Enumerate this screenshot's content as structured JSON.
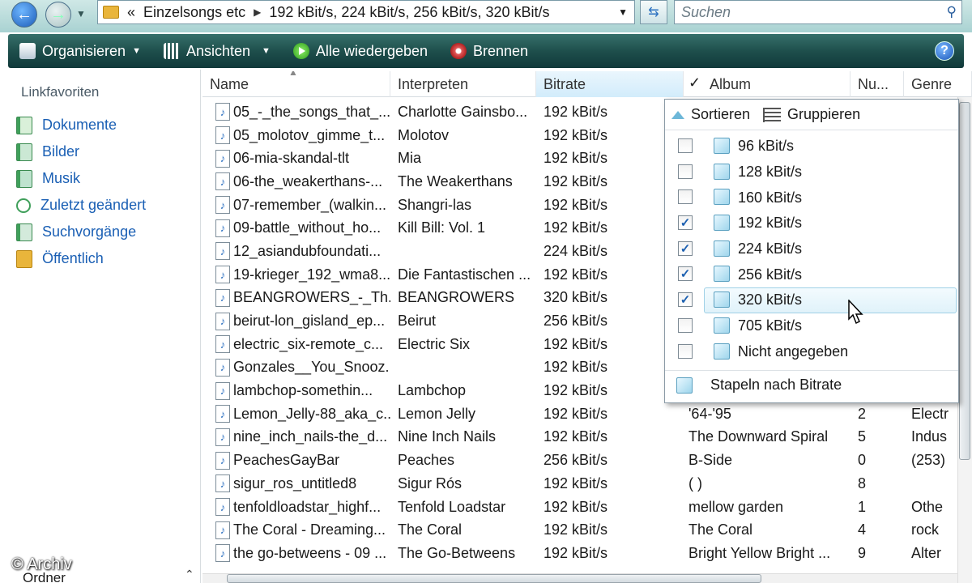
{
  "address": {
    "path_prefix": "«",
    "crumbs": [
      "Einzelsongs etc",
      "192 kBit/s, 224 kBit/s, 256 kBit/s, 320 kBit/s"
    ],
    "search_placeholder": "Suchen"
  },
  "toolbar": {
    "organize": "Organisieren",
    "views": "Ansichten",
    "play_all": "Alle wiedergeben",
    "burn": "Brennen",
    "help": "?"
  },
  "nav": {
    "heading": "Linkfavoriten",
    "items": [
      {
        "label": "Dokumente",
        "icon": "documents-icon"
      },
      {
        "label": "Bilder",
        "icon": "pictures-icon"
      },
      {
        "label": "Musik",
        "icon": "music-icon"
      },
      {
        "label": "Zuletzt geändert",
        "icon": "recent-icon"
      },
      {
        "label": "Suchvorgänge",
        "icon": "searches-icon"
      },
      {
        "label": "Öffentlich",
        "icon": "public-folder-icon"
      }
    ],
    "folders_label": "Ordner"
  },
  "columns": {
    "name": "Name",
    "artist": "Interpreten",
    "bitrate": "Bitrate",
    "album": "Album",
    "num": "Nu...",
    "genre": "Genre"
  },
  "rows": [
    {
      "name": "05_-_the_songs_that_...",
      "artist": "Charlotte Gainsbo...",
      "bitrate": "192 kBit/s",
      "album": "",
      "num": "",
      "genre": ""
    },
    {
      "name": "05_molotov_gimme_t...",
      "artist": "Molotov",
      "bitrate": "192 kBit/s",
      "album": "",
      "num": "",
      "genre": ""
    },
    {
      "name": "06-mia-skandal-tlt",
      "artist": "Mia",
      "bitrate": "192 kBit/s",
      "album": "",
      "num": "",
      "genre": ""
    },
    {
      "name": "06-the_weakerthans-...",
      "artist": "The Weakerthans",
      "bitrate": "192 kBit/s",
      "album": "",
      "num": "",
      "genre": ""
    },
    {
      "name": "07-remember_(walkin...",
      "artist": "Shangri-las",
      "bitrate": "192 kBit/s",
      "album": "",
      "num": "",
      "genre": ""
    },
    {
      "name": "09-battle_without_ho...",
      "artist": "Kill Bill: Vol. 1",
      "bitrate": "192 kBit/s",
      "album": "",
      "num": "",
      "genre": ""
    },
    {
      "name": "12_asiandubfoundati...",
      "artist": "",
      "bitrate": "224 kBit/s",
      "album": "",
      "num": "",
      "genre": ""
    },
    {
      "name": "19-krieger_192_wma8...",
      "artist": "Die Fantastischen ...",
      "bitrate": "192 kBit/s",
      "album": "",
      "num": "",
      "genre": ""
    },
    {
      "name": "BEANGROWERS_-_Th...",
      "artist": "BEANGROWERS",
      "bitrate": "320 kBit/s",
      "album": "",
      "num": "",
      "genre": ""
    },
    {
      "name": "beirut-lon_gisland_ep...",
      "artist": "Beirut",
      "bitrate": "256 kBit/s",
      "album": "",
      "num": "",
      "genre": ""
    },
    {
      "name": "electric_six-remote_c...",
      "artist": "Electric Six",
      "bitrate": "192 kBit/s",
      "album": "",
      "num": "",
      "genre": ""
    },
    {
      "name": "Gonzales__You_Snooz...",
      "artist": "",
      "bitrate": "192 kBit/s",
      "album": "",
      "num": "",
      "genre": ""
    },
    {
      "name": "lambchop-somethin...",
      "artist": "Lambchop",
      "bitrate": "192 kBit/s",
      "album": "",
      "num": "",
      "genre": ""
    },
    {
      "name": "Lemon_Jelly-88_aka_c...",
      "artist": "Lemon Jelly",
      "bitrate": "192 kBit/s",
      "album": "'64-'95",
      "num": "2",
      "genre": "Electr"
    },
    {
      "name": "nine_inch_nails-the_d...",
      "artist": "Nine Inch Nails",
      "bitrate": "192 kBit/s",
      "album": "The Downward Spiral",
      "num": "5",
      "genre": "Indus"
    },
    {
      "name": "PeachesGayBar",
      "artist": "Peaches",
      "bitrate": "256 kBit/s",
      "album": "B-Side",
      "num": "0",
      "genre": "(253)"
    },
    {
      "name": "sigur_ros_untitled8",
      "artist": "Sigur Rós",
      "bitrate": "192 kBit/s",
      "album": "( )",
      "num": "8",
      "genre": ""
    },
    {
      "name": "tenfoldloadstar_highf...",
      "artist": "Tenfold Loadstar",
      "bitrate": "192 kBit/s",
      "album": "mellow garden",
      "num": "1",
      "genre": "Othe"
    },
    {
      "name": "The Coral - Dreaming...",
      "artist": "The Coral",
      "bitrate": "192 kBit/s",
      "album": "The Coral",
      "num": "4",
      "genre": "rock"
    },
    {
      "name": "the go-betweens - 09 ...",
      "artist": "The Go-Betweens",
      "bitrate": "192 kBit/s",
      "album": "Bright Yellow Bright ...",
      "num": "9",
      "genre": "Alter"
    }
  ],
  "popup": {
    "sort": "Sortieren",
    "group": "Gruppieren",
    "items": [
      {
        "label": "96 kBit/s",
        "checked": false
      },
      {
        "label": "128 kBit/s",
        "checked": false
      },
      {
        "label": "160 kBit/s",
        "checked": false
      },
      {
        "label": "192 kBit/s",
        "checked": true
      },
      {
        "label": "224 kBit/s",
        "checked": true
      },
      {
        "label": "256 kBit/s",
        "checked": true
      },
      {
        "label": "320 kBit/s",
        "checked": true
      },
      {
        "label": "705 kBit/s",
        "checked": false
      },
      {
        "label": "Nicht angegeben",
        "checked": false
      }
    ],
    "stack": "Stapeln nach Bitrate"
  },
  "watermark": "© Archiv"
}
